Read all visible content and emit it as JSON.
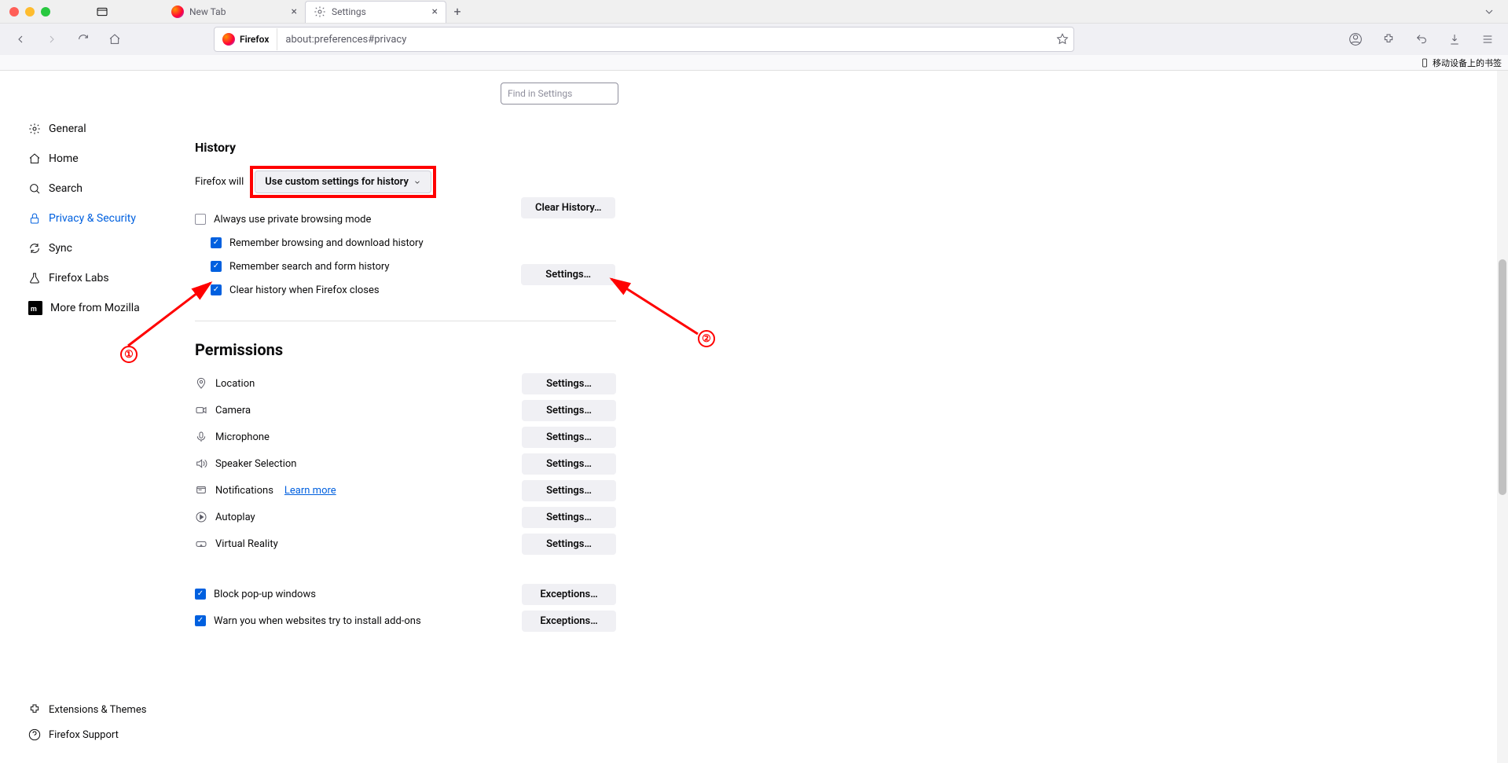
{
  "titlebar": {
    "tabs": [
      {
        "label": "New Tab",
        "active": false
      },
      {
        "label": "Settings",
        "active": true
      }
    ]
  },
  "toolbar": {
    "identity": "Firefox",
    "url": "about:preferences#privacy",
    "bookmarks_mobile": "移动设备上的书签"
  },
  "sidebar": {
    "items": [
      {
        "label": "General"
      },
      {
        "label": "Home"
      },
      {
        "label": "Search"
      },
      {
        "label": "Privacy & Security"
      },
      {
        "label": "Sync"
      },
      {
        "label": "Firefox Labs"
      },
      {
        "label": "More from Mozilla"
      }
    ],
    "bottom": [
      {
        "label": "Extensions & Themes"
      },
      {
        "label": "Firefox Support"
      }
    ]
  },
  "search": {
    "placeholder": "Find in Settings"
  },
  "history": {
    "heading": "History",
    "firefox_will": "Firefox will",
    "dropdown": "Use custom settings for history",
    "always_private": "Always use private browsing mode",
    "remember_browsing": "Remember browsing and download history",
    "remember_search": "Remember search and form history",
    "clear_on_close": "Clear history when Firefox closes",
    "clear_btn": "Clear History…",
    "settings_btn": "Settings…"
  },
  "permissions": {
    "heading": "Permissions",
    "items": [
      {
        "label": "Location",
        "btn": "Settings…"
      },
      {
        "label": "Camera",
        "btn": "Settings…"
      },
      {
        "label": "Microphone",
        "btn": "Settings…"
      },
      {
        "label": "Speaker Selection",
        "btn": "Settings…"
      },
      {
        "label": "Notifications",
        "btn": "Settings…",
        "learn": "Learn more"
      },
      {
        "label": "Autoplay",
        "btn": "Settings…"
      },
      {
        "label": "Virtual Reality",
        "btn": "Settings…"
      }
    ],
    "block_popups": "Block pop-up windows",
    "warn_addons": "Warn you when websites try to install add-ons",
    "exceptions_btn": "Exceptions…"
  },
  "annotations": {
    "one": "①",
    "two": "②"
  }
}
